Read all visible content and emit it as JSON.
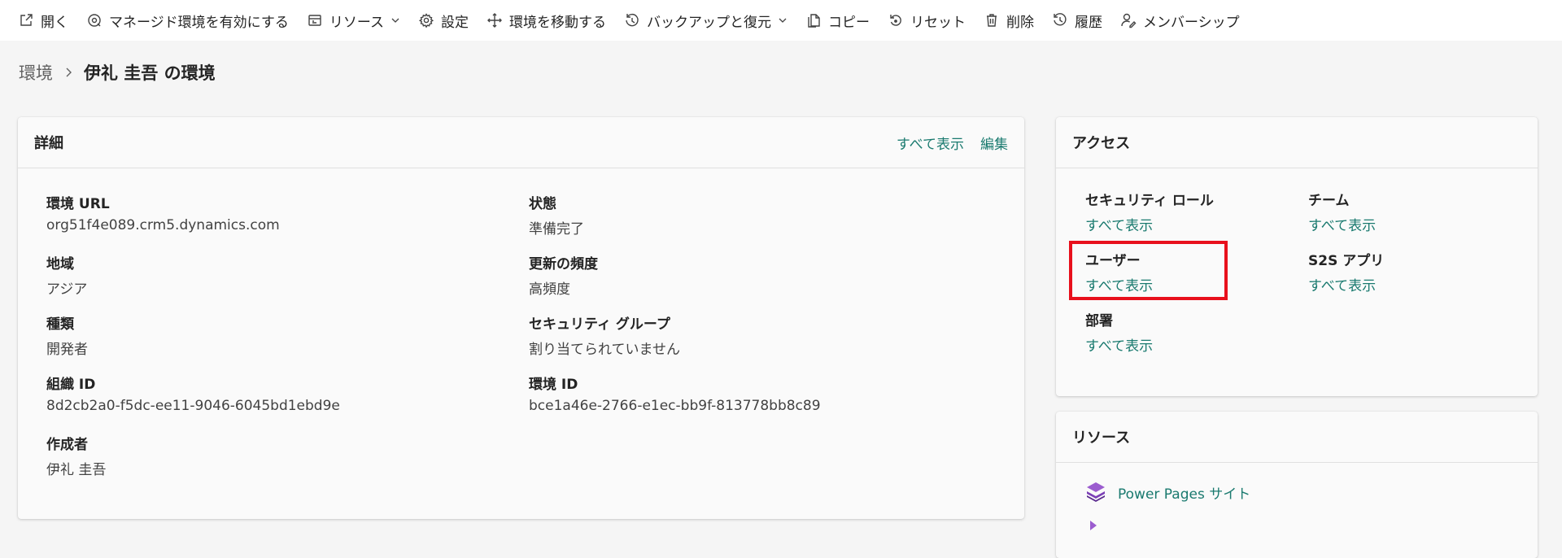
{
  "toolbar": {
    "items": [
      {
        "label": "開く",
        "icon": "open-external-icon"
      },
      {
        "label": "マネージド環境を有効にする",
        "icon": "managed-environment-icon"
      },
      {
        "label": "リソース",
        "icon": "resources-icon",
        "dropdown": true
      },
      {
        "label": "設定",
        "icon": "gear-icon"
      },
      {
        "label": "環境を移動する",
        "icon": "move-icon"
      },
      {
        "label": "バックアップと復元",
        "icon": "backup-restore-icon",
        "dropdown": true
      },
      {
        "label": "コピー",
        "icon": "copy-icon"
      },
      {
        "label": "リセット",
        "icon": "reset-icon"
      },
      {
        "label": "削除",
        "icon": "trash-icon"
      },
      {
        "label": "履歴",
        "icon": "history-icon"
      },
      {
        "label": "メンバーシップ",
        "icon": "membership-icon"
      }
    ]
  },
  "breadcrumb": {
    "root": "環境",
    "current": "伊礼 圭吾 の環境"
  },
  "details": {
    "title": "詳細",
    "show_all": "すべて表示",
    "edit": "編集",
    "fields": {
      "env_url": {
        "label": "環境 URL",
        "value": "org51f4e089.crm5.dynamics.com"
      },
      "state": {
        "label": "状態",
        "value": "準備完了"
      },
      "region": {
        "label": "地域",
        "value": "アジア"
      },
      "update_cadence": {
        "label": "更新の頻度",
        "value": "高頻度"
      },
      "type": {
        "label": "種類",
        "value": "開発者"
      },
      "security_group": {
        "label": "セキュリティ グループ",
        "value": "割り当てられていません"
      },
      "org_id": {
        "label": "組織 ID",
        "value": "8d2cb2a0-f5dc-ee11-9046-6045bd1ebd9e"
      },
      "env_id": {
        "label": "環境 ID",
        "value": "bce1a46e-2766-e1ec-bb9f-813778bb8c89"
      },
      "created_by": {
        "label": "作成者",
        "value": "伊礼 圭吾"
      }
    }
  },
  "access": {
    "title": "アクセス",
    "items": {
      "security_roles": {
        "label": "セキュリティ ロール",
        "link": "すべて表示"
      },
      "teams": {
        "label": "チーム",
        "link": "すべて表示"
      },
      "users": {
        "label": "ユーザー",
        "link": "すべて表示"
      },
      "s2s_apps": {
        "label": "S2S アプリ",
        "link": "すべて表示"
      },
      "business_units": {
        "label": "部署",
        "link": "すべて表示"
      }
    }
  },
  "resources": {
    "title": "リソース",
    "items": [
      {
        "label": "Power Pages サイト",
        "icon": "power-pages-icon"
      }
    ]
  },
  "colors": {
    "accent_link": "#1a7a6f",
    "highlight": "#e8101c",
    "power_pages": "#7b3fb6"
  }
}
